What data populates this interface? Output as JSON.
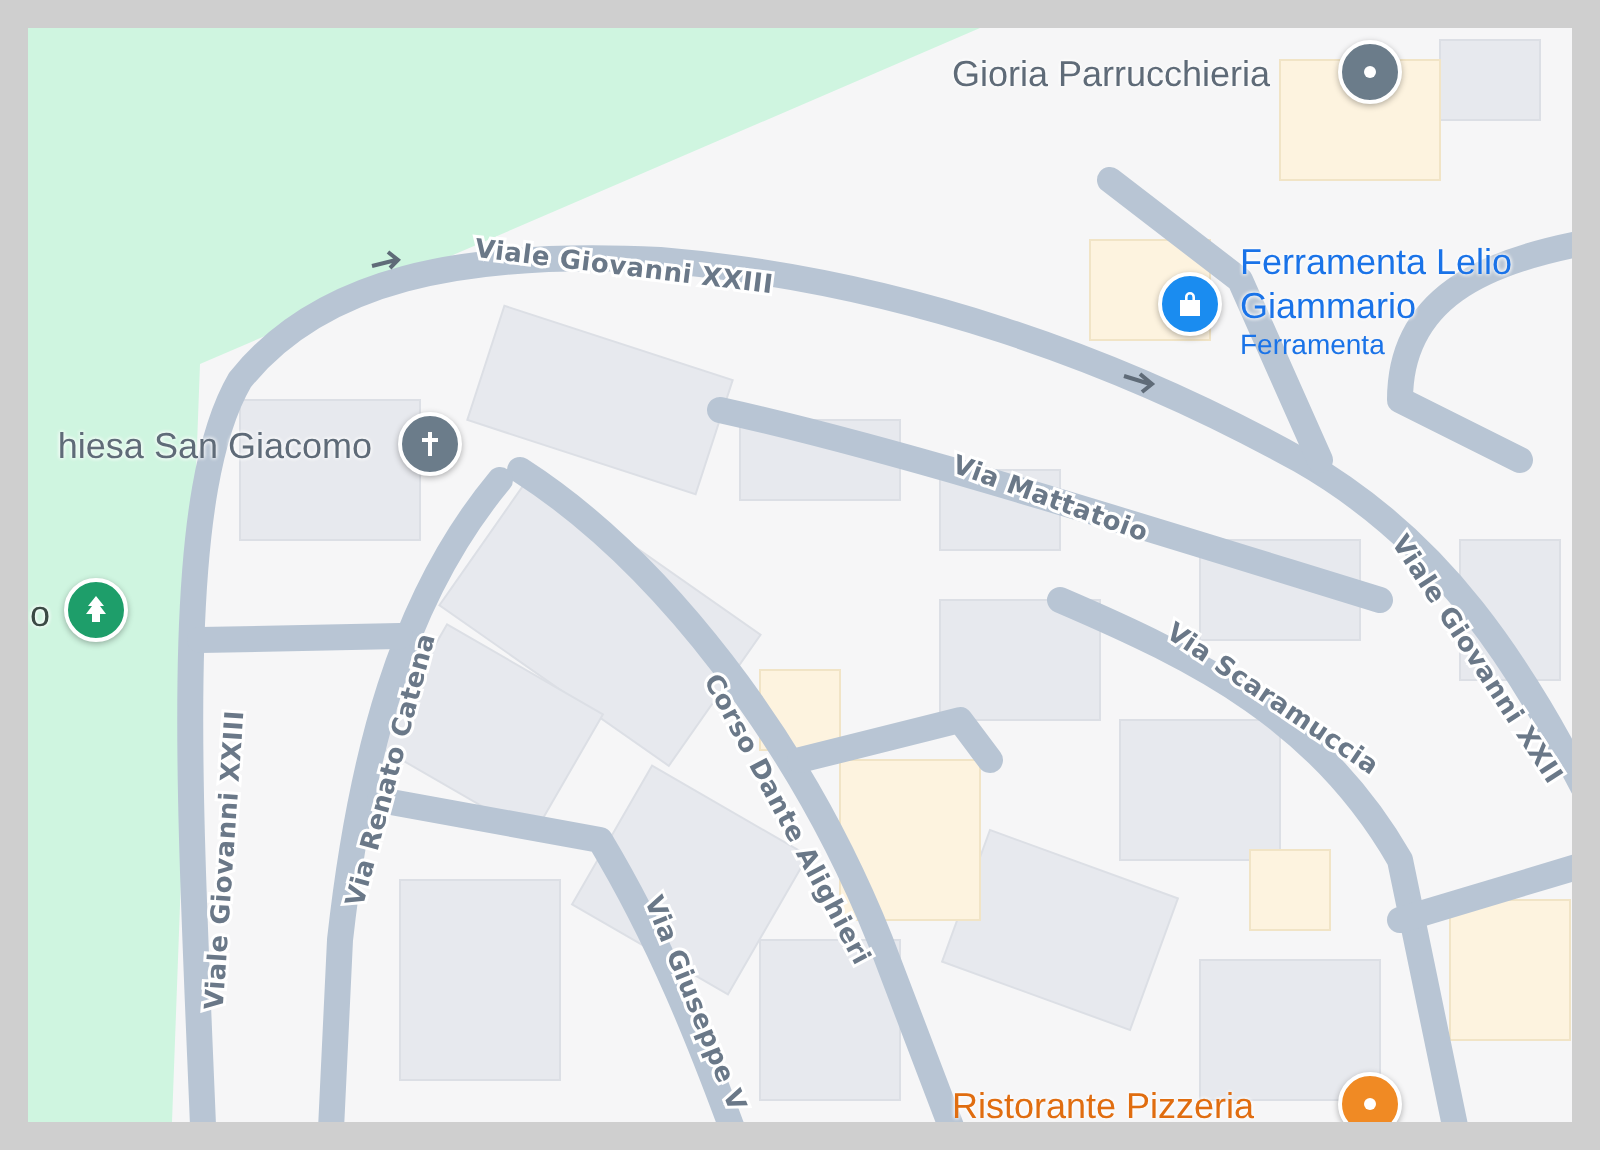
{
  "map": {
    "pois": [
      {
        "kind": "hair",
        "name": "Gioria Parrucchieria"
      },
      {
        "kind": "shop",
        "name": "Ferramenta Lelio Giammario",
        "category": "Ferramenta"
      },
      {
        "kind": "church",
        "name": "hiesa San Giacomo"
      },
      {
        "kind": "park",
        "name": "o"
      },
      {
        "kind": "restaurant",
        "name": "Ristorante Pizzeria"
      }
    ],
    "streets": [
      {
        "name": "Viale Giovanni XXIII"
      },
      {
        "name": "Via Mattatoio"
      },
      {
        "name": "Viale Giovanni XXII"
      },
      {
        "name": "Via Scaramuccia"
      },
      {
        "name": "Corso Dante Alighieri"
      },
      {
        "name": "Via Renato Catena"
      },
      {
        "name": "Viale Giovanni XXIII"
      },
      {
        "name": "Via Giuseppe V"
      }
    ]
  }
}
